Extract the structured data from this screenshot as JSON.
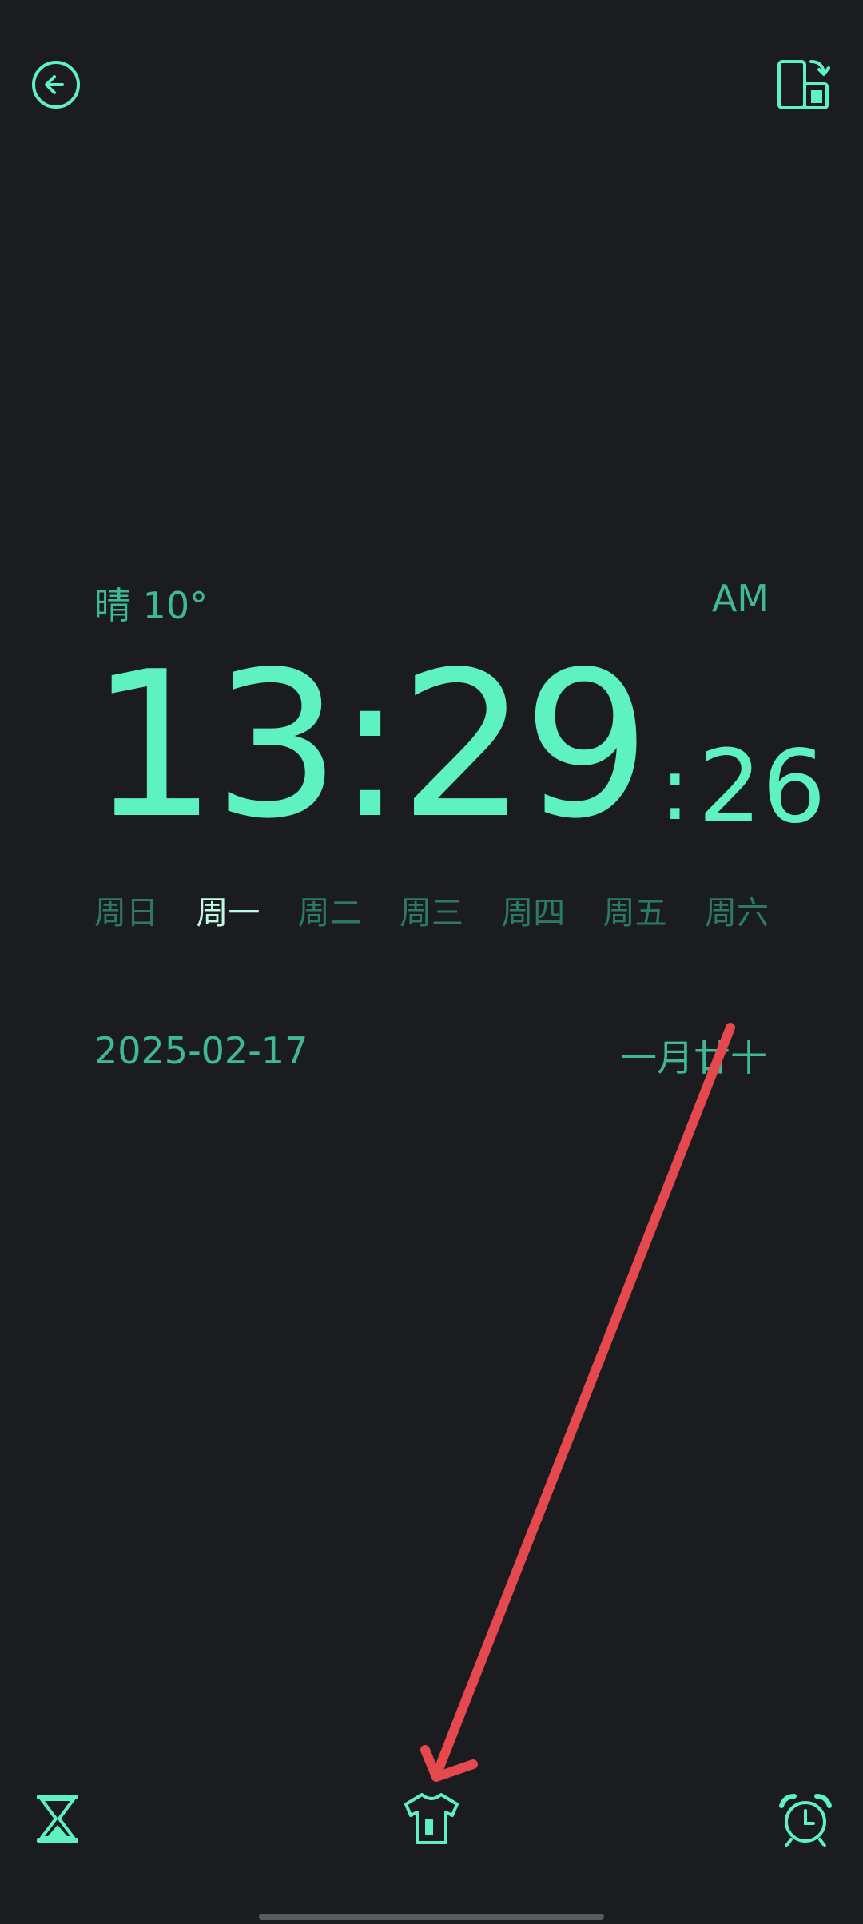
{
  "top_bar": {
    "back_icon": "arrow-left-circle-icon",
    "rotate_icon": "screen-rotate-icon"
  },
  "weather": {
    "text": "晴 10°"
  },
  "ampm": "AM",
  "clock": {
    "hm": "13:29",
    "sec_colon": ":",
    "sec": "26"
  },
  "weekdays": [
    {
      "label": "周日",
      "active": false
    },
    {
      "label": "周一",
      "active": true
    },
    {
      "label": "周二",
      "active": false
    },
    {
      "label": "周三",
      "active": false
    },
    {
      "label": "周四",
      "active": false
    },
    {
      "label": "周五",
      "active": false
    },
    {
      "label": "周六",
      "active": false
    }
  ],
  "date": "2025-02-17",
  "lunar": "一月廿十",
  "bottom_bar": {
    "timer_icon": "hourglass-icon",
    "theme_icon": "tshirt-icon",
    "alarm_icon": "alarm-clock-icon"
  },
  "colors": {
    "background": "#1b1c20",
    "accent": "#5ef2c0",
    "muted": "#3fb896",
    "weekday_inactive": "#2c7a66",
    "weekday_active": "#bffbe4",
    "annotation": "#e5484d"
  }
}
